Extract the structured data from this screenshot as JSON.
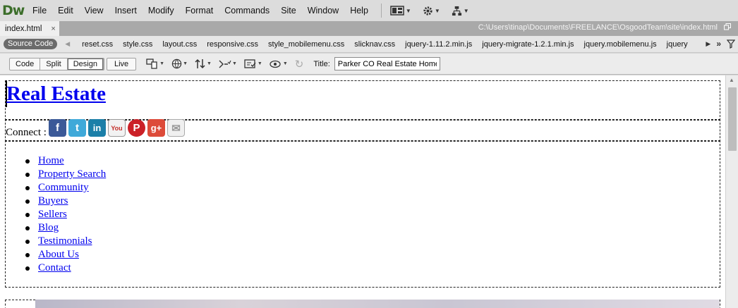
{
  "app": {
    "logo": "Dw"
  },
  "menu": [
    "File",
    "Edit",
    "View",
    "Insert",
    "Modify",
    "Format",
    "Commands",
    "Site",
    "Window",
    "Help"
  ],
  "toolbar_icons": [
    "layout-icon",
    "gear-icon",
    "site-tree-icon"
  ],
  "doc_tab": {
    "label": "index.html",
    "close": "×"
  },
  "file_path": "C:\\Users\\tinap\\Documents\\FREELANCE\\OsgoodTeam\\site\\index.html",
  "related_files": {
    "source_code": "Source Code",
    "files": [
      "reset.css",
      "style.css",
      "layout.css",
      "responsive.css",
      "style_mobilemenu.css",
      "slicknav.css",
      "jquery-1.11.2.min.js",
      "jquery-migrate-1.2.1.min.js",
      "jquery.mobilemenu.js",
      "jquery"
    ]
  },
  "view_buttons": {
    "code": "Code",
    "split": "Split",
    "design": "Design",
    "live": "Live"
  },
  "doc_title": {
    "label": "Title:",
    "value": "Parker CO Real Estate Homes"
  },
  "page": {
    "heading": "Real Estate",
    "connect_label": "Connect :",
    "social": [
      {
        "name": "facebook",
        "glyph": "f",
        "color": "#3b5998"
      },
      {
        "name": "twitter",
        "glyph": "t",
        "color": "#3fa9d9"
      },
      {
        "name": "linkedin",
        "glyph": "in",
        "color": "#1b7fa8"
      },
      {
        "name": "youtube",
        "glyph": "You",
        "color": "#f2f2f2"
      },
      {
        "name": "pinterest",
        "glyph": "P",
        "color": "#cb2027"
      },
      {
        "name": "google-plus",
        "glyph": "g+",
        "color": "#dd4b39"
      },
      {
        "name": "email",
        "glyph": "✉",
        "color": "#f0f0f0"
      }
    ],
    "nav": [
      "Home",
      "Property Search",
      "Community",
      "Buyers",
      "Sellers",
      "Blog",
      "Testimonials",
      "About Us",
      "Contact"
    ]
  }
}
